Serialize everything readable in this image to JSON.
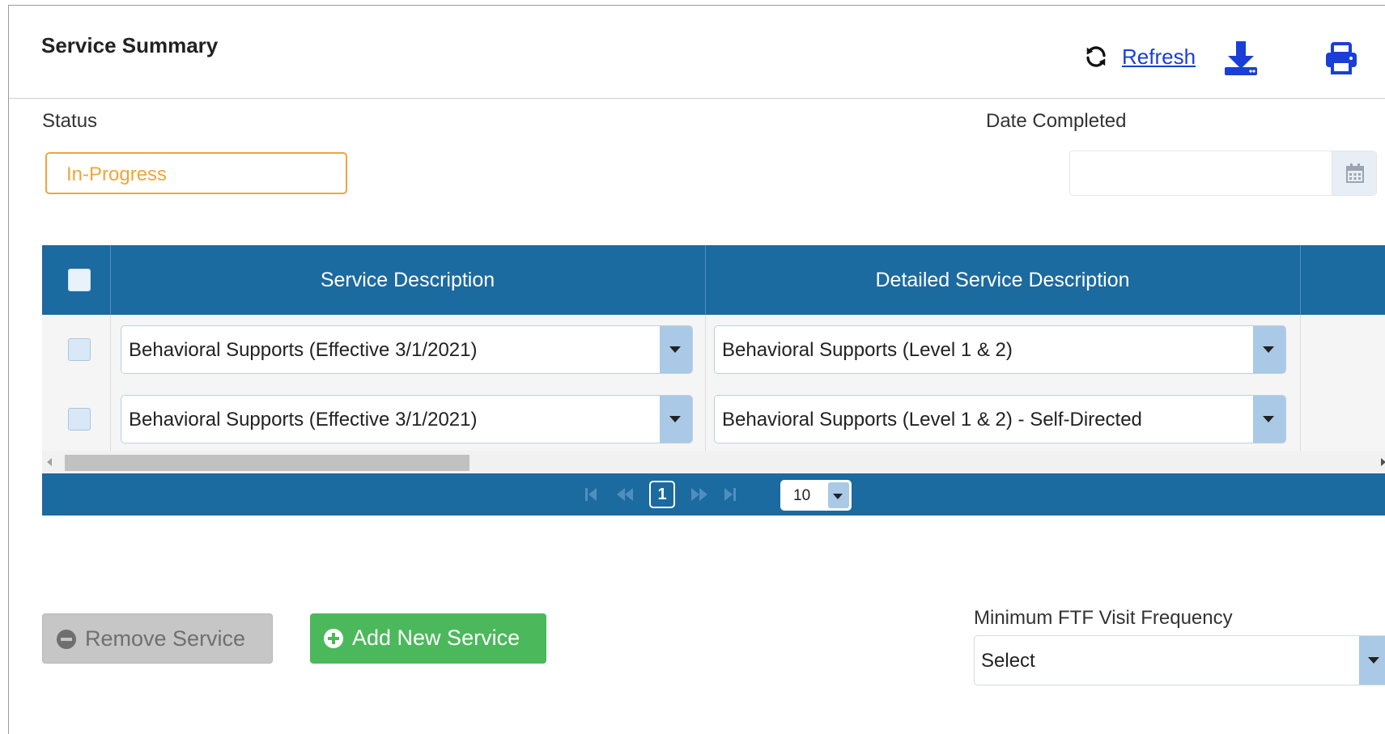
{
  "header": {
    "title": "Service Summary",
    "refresh_label": "Refresh"
  },
  "status": {
    "label": "Status",
    "value": "In-Progress"
  },
  "date_completed": {
    "label": "Date Completed",
    "value": ""
  },
  "grid": {
    "columns": [
      "Service Description",
      "Detailed Service Description"
    ],
    "rows": [
      {
        "service": "Behavioral Supports (Effective 3/1/2021)",
        "detail": "Behavioral Supports (Level 1 & 2)"
      },
      {
        "service": "Behavioral Supports (Effective 3/1/2021)",
        "detail": "Behavioral Supports (Level 1 & 2) - Self-Directed"
      }
    ]
  },
  "pager": {
    "current_page": "1",
    "page_size": "10"
  },
  "buttons": {
    "remove_label": "Remove Service",
    "add_label": "Add New Service"
  },
  "ftf": {
    "label": "Minimum FTF Visit Frequency",
    "value": "Select"
  },
  "colors": {
    "header_blue": "#1b6aa0",
    "status_orange": "#f0a53a",
    "add_green": "#4cb85c",
    "link_blue": "#1a3fd6"
  }
}
